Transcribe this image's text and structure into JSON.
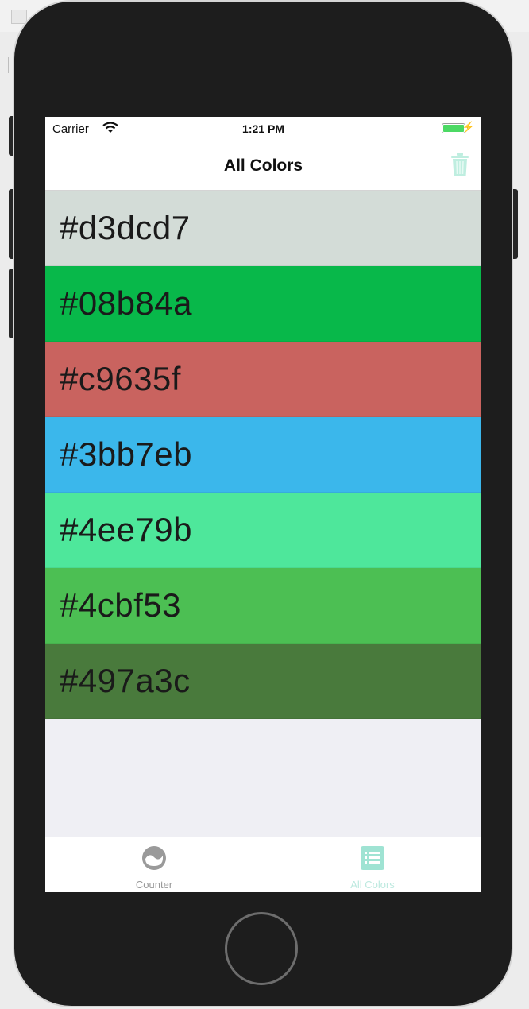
{
  "status_bar": {
    "carrier": "Carrier",
    "time": "1:21 PM"
  },
  "nav": {
    "title": "All Colors"
  },
  "colors": [
    {
      "label": "#d3dcd7",
      "value": "#d3dcd7"
    },
    {
      "label": "#08b84a",
      "value": "#08b84a"
    },
    {
      "label": "#c9635f",
      "value": "#c9635f"
    },
    {
      "label": "#3bb7eb",
      "value": "#3bb7eb"
    },
    {
      "label": "#4ee79b",
      "value": "#4ee79b"
    },
    {
      "label": "#4cbf53",
      "value": "#4cbf53"
    },
    {
      "label": "#497a3c",
      "value": "#497a3c"
    }
  ],
  "tabs": [
    {
      "label": "Counter",
      "icon": "counter-icon"
    },
    {
      "label": "All Colors",
      "icon": "list-icon",
      "selected": true
    }
  ],
  "accent_color": "#7ed6c6"
}
